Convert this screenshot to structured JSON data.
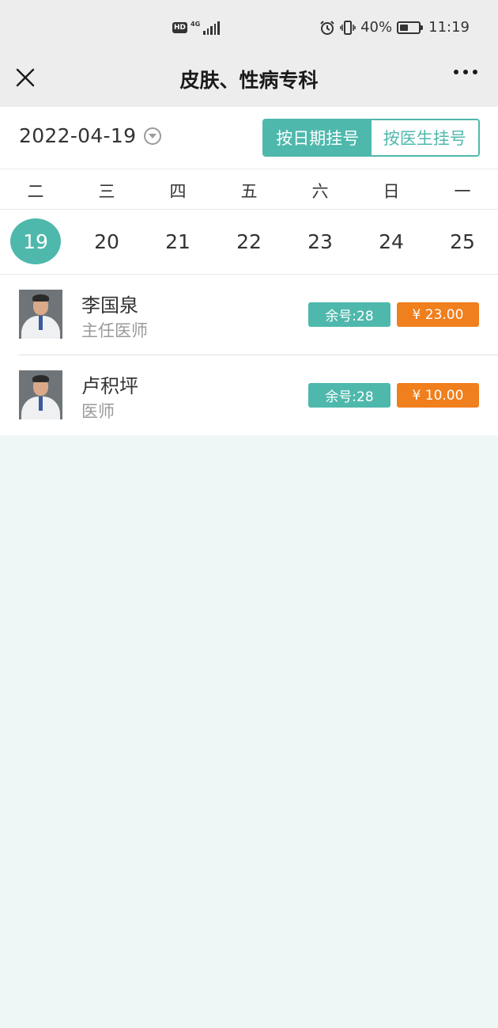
{
  "status_bar": {
    "hd": "HD",
    "network": "4G",
    "battery": "40%",
    "time": "11:19"
  },
  "nav": {
    "title": "皮肤、性病专科",
    "close_icon": "close-icon",
    "more_icon": "more-icon"
  },
  "date_picker": {
    "value": "2022-04-19"
  },
  "mode_switch": {
    "by_date": "按日期挂号",
    "by_doctor": "按医生挂号"
  },
  "weekdays": [
    "二",
    "三",
    "四",
    "五",
    "六",
    "日",
    "一"
  ],
  "days": [
    "19",
    "20",
    "21",
    "22",
    "23",
    "24",
    "25"
  ],
  "selected_day": "19",
  "doctors": [
    {
      "name": "李国泉",
      "title": "主任医师",
      "remaining": "余号:28",
      "price": "¥ 23.00"
    },
    {
      "name": "卢积坪",
      "title": "医师",
      "remaining": "余号:28",
      "price": "¥ 10.00"
    }
  ],
  "colors": {
    "accent": "#4fb8ac",
    "price": "#f07f1d",
    "page_bg": "#eff7f6",
    "bar_bg": "#ededed"
  }
}
